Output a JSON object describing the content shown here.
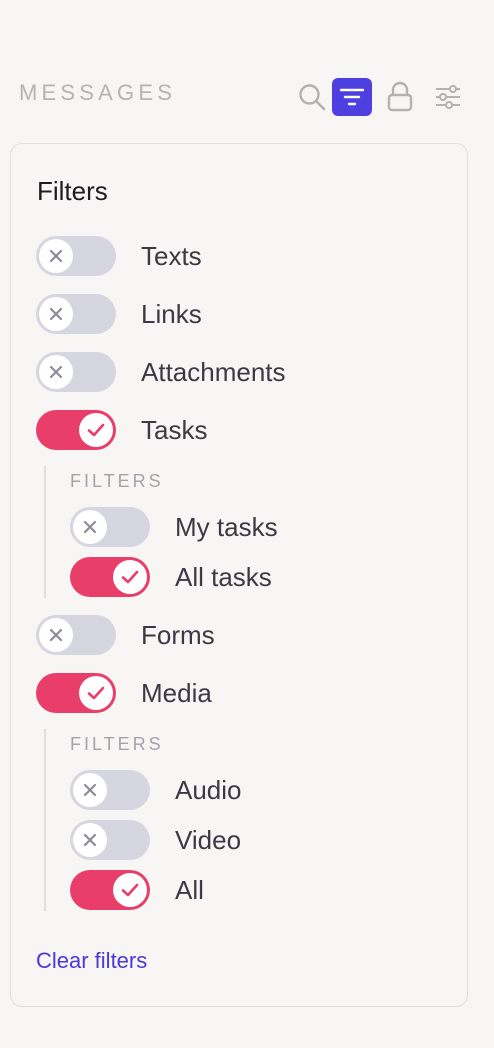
{
  "header": {
    "title": "MESSAGES",
    "icons": [
      "search-icon",
      "filter-icon",
      "lock-icon",
      "sliders-icon"
    ],
    "active_icon": "filter-icon",
    "accent_color": "#4d3fe0"
  },
  "panel": {
    "title": "Filters",
    "items": [
      {
        "label": "Texts",
        "on": false
      },
      {
        "label": "Links",
        "on": false
      },
      {
        "label": "Attachments",
        "on": false
      },
      {
        "label": "Tasks",
        "on": true
      },
      {
        "label": "Forms",
        "on": false
      },
      {
        "label": "Media",
        "on": true
      }
    ],
    "tasks_filters": {
      "label": "FILTERS",
      "items": [
        {
          "label": "My tasks",
          "on": false
        },
        {
          "label": "All tasks",
          "on": true
        }
      ]
    },
    "media_filters": {
      "label": "FILTERS",
      "items": [
        {
          "label": "Audio",
          "on": false
        },
        {
          "label": "Video",
          "on": false
        },
        {
          "label": "All",
          "on": true
        }
      ]
    },
    "clear_label": "Clear filters"
  },
  "colors": {
    "toggle_on": "#ea3e6a",
    "toggle_off": "#d6d6e0",
    "link": "#4a38d9"
  }
}
